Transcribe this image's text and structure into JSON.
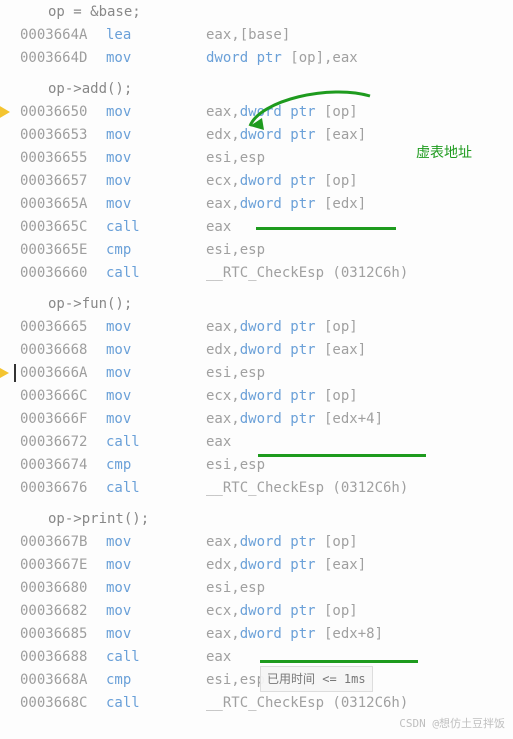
{
  "annotation_text": "虚表地址",
  "hint_text": "已用时间 <= 1ms",
  "watermark": "CSDN @想仿土豆拌饭",
  "blocks": [
    {
      "src": "op = &base;",
      "lines": [
        {
          "addr": "0003664A",
          "mnem": "lea",
          "ops": "eax,[base]"
        },
        {
          "addr": "0003664D",
          "mnem": "mov",
          "ops": "dword ptr [op],eax"
        }
      ]
    },
    {
      "src": "op->add();",
      "lines": [
        {
          "addr": "00036650",
          "mnem": "mov",
          "ops": "eax,dword ptr [op]",
          "marker": "cur"
        },
        {
          "addr": "00036653",
          "mnem": "mov",
          "ops": "edx,dword ptr [eax]"
        },
        {
          "addr": "00036655",
          "mnem": "mov",
          "ops": "esi,esp"
        },
        {
          "addr": "00036657",
          "mnem": "mov",
          "ops": "ecx,dword ptr [op]"
        },
        {
          "addr": "0003665A",
          "mnem": "mov",
          "ops": "eax,dword ptr [edx]"
        },
        {
          "addr": "0003665C",
          "mnem": "call",
          "ops": "eax"
        },
        {
          "addr": "0003665E",
          "mnem": "cmp",
          "ops": "esi,esp"
        },
        {
          "addr": "00036660",
          "mnem": "call",
          "ops": "__RTC_CheckEsp (0312C6h)"
        }
      ]
    },
    {
      "src": "op->fun();",
      "lines": [
        {
          "addr": "00036665",
          "mnem": "mov",
          "ops": "eax,dword ptr [op]"
        },
        {
          "addr": "00036668",
          "mnem": "mov",
          "ops": "edx,dword ptr [eax]"
        },
        {
          "addr": "0003666A",
          "mnem": "mov",
          "ops": "esi,esp",
          "marker": "next",
          "cursor": true
        },
        {
          "addr": "0003666C",
          "mnem": "mov",
          "ops": "ecx,dword ptr [op]"
        },
        {
          "addr": "0003666F",
          "mnem": "mov",
          "ops": "eax,dword ptr [edx+4]"
        },
        {
          "addr": "00036672",
          "mnem": "call",
          "ops": "eax"
        },
        {
          "addr": "00036674",
          "mnem": "cmp",
          "ops": "esi,esp"
        },
        {
          "addr": "00036676",
          "mnem": "call",
          "ops": "__RTC_CheckEsp (0312C6h)"
        }
      ]
    },
    {
      "src": "op->print();",
      "lines": [
        {
          "addr": "0003667B",
          "mnem": "mov",
          "ops": "eax,dword ptr [op]"
        },
        {
          "addr": "0003667E",
          "mnem": "mov",
          "ops": "edx,dword ptr [eax]"
        },
        {
          "addr": "00036680",
          "mnem": "mov",
          "ops": "esi,esp"
        },
        {
          "addr": "00036682",
          "mnem": "mov",
          "ops": "ecx,dword ptr [op]"
        },
        {
          "addr": "00036685",
          "mnem": "mov",
          "ops": "eax,dword ptr [edx+8]"
        },
        {
          "addr": "00036688",
          "mnem": "call",
          "ops": "eax"
        },
        {
          "addr": "0003668A",
          "mnem": "cmp",
          "ops": "esi,esp"
        },
        {
          "addr": "0003668C",
          "mnem": "call",
          "ops": "__RTC_CheckEsp (0312C6h)"
        }
      ]
    }
  ]
}
